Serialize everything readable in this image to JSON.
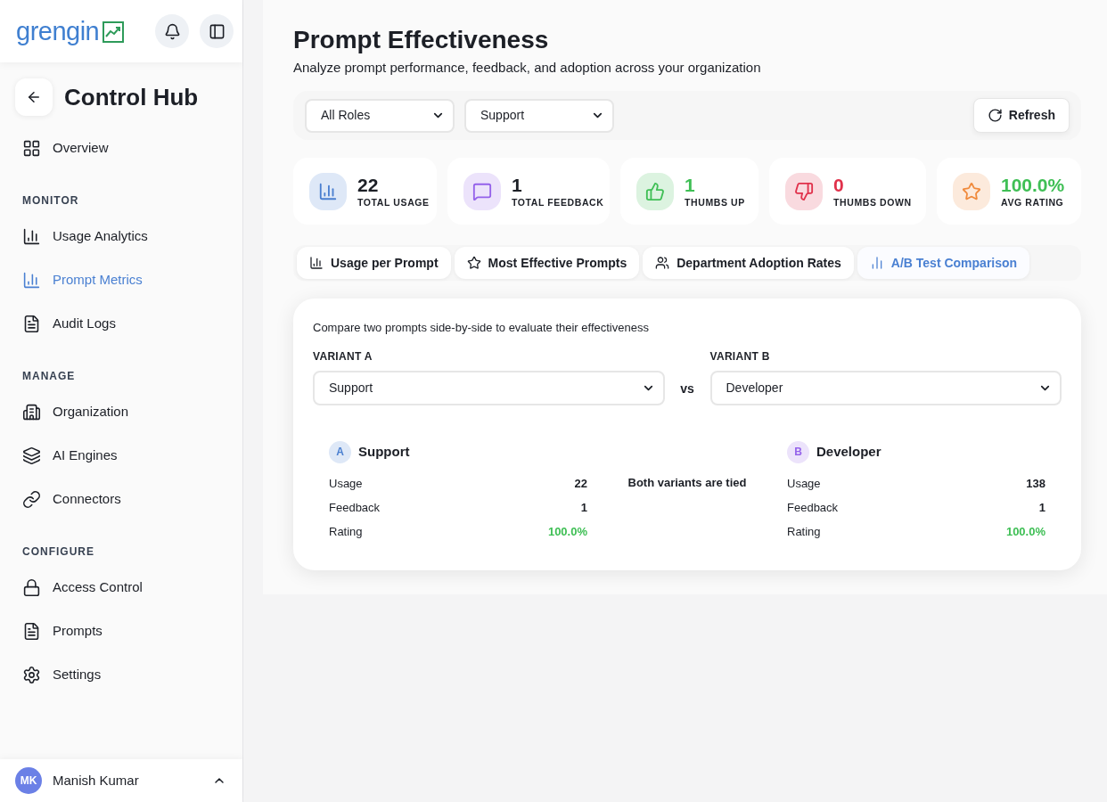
{
  "sidebar": {
    "logo": {
      "text": "grengin"
    },
    "title": "Control Hub",
    "nav": [
      {
        "items": [
          {
            "label": "Overview",
            "selected": false
          }
        ]
      },
      {
        "heading": "MONITOR",
        "items": [
          {
            "label": "Usage Analytics",
            "selected": false
          },
          {
            "label": "Prompt Metrics",
            "selected": true
          },
          {
            "label": "Audit Logs",
            "selected": false
          }
        ]
      },
      {
        "heading": "MANAGE",
        "items": [
          {
            "label": "Organization",
            "selected": false
          },
          {
            "label": "AI Engines",
            "selected": false
          },
          {
            "label": "Connectors",
            "selected": false
          }
        ]
      },
      {
        "heading": "CONFIGURE",
        "items": [
          {
            "label": "Access Control",
            "selected": false
          },
          {
            "label": "Prompts",
            "selected": false
          },
          {
            "label": "Settings",
            "selected": false
          }
        ]
      }
    ],
    "user": {
      "initials": "MK",
      "name": "Manish Kumar"
    }
  },
  "main": {
    "title": "Prompt Effectiveness",
    "subtitle": "Analyze prompt performance, feedback, and adoption across your organization",
    "filters": [
      {
        "value": "All Roles"
      },
      {
        "value": "Support"
      }
    ],
    "refresh": "Refresh",
    "stats": [
      {
        "value": "22",
        "label": "TOTAL USAGE",
        "color": "#4a7fd0",
        "kind": "plain"
      },
      {
        "value": "1",
        "label": "TOTAL FEEDBACK",
        "color": "#9462ea",
        "kind": "plain"
      },
      {
        "value": "1",
        "label": "THUMBS UP",
        "color": "#3fbf55",
        "kind": "positive"
      },
      {
        "value": "0",
        "label": "THUMBS DOWN",
        "color": "#e0314b",
        "kind": "negative"
      },
      {
        "value": "100.0%",
        "label": "AVG RATING",
        "color": "#f08a3c",
        "kind": "positive"
      }
    ],
    "tabs": [
      {
        "label": "Usage per Prompt",
        "selected": false
      },
      {
        "label": "Most Effective Prompts",
        "selected": false
      },
      {
        "label": "Department Adoption Rates",
        "selected": false
      },
      {
        "label": "A/B Test Comparison",
        "selected": true
      }
    ],
    "comparison": {
      "description": "Compare two prompts side-by-side to evaluate their effectiveness",
      "variants": [
        {
          "label": "VARIANT A",
          "value": "Support"
        },
        {
          "label": "VARIANT B",
          "value": "Developer"
        }
      ],
      "vs": "vs",
      "results": [
        {
          "badge": "A",
          "name": "Support",
          "color": "#4a7fd0",
          "rows": [
            {
              "label": "Usage",
              "value": "22",
              "kind": "plain"
            },
            {
              "label": "Feedback",
              "value": "1",
              "kind": "plain"
            },
            {
              "label": "Rating",
              "value": "100.0%",
              "kind": "positive"
            }
          ]
        },
        {
          "badge": "B",
          "name": "Developer",
          "color": "#9462ea",
          "rows": [
            {
              "label": "Usage",
              "value": "138",
              "kind": "plain"
            },
            {
              "label": "Feedback",
              "value": "1",
              "kind": "plain"
            },
            {
              "label": "Rating",
              "value": "100.0%",
              "kind": "positive"
            }
          ]
        }
      ],
      "verdict": "Both variants are tied"
    }
  }
}
